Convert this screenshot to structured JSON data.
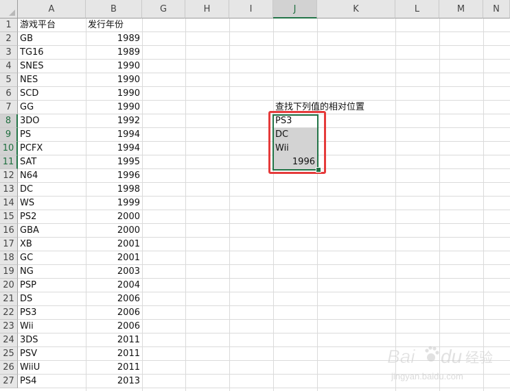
{
  "columns": [
    "A",
    "B",
    "G",
    "H",
    "I",
    "J",
    "K",
    "L",
    "M",
    "N"
  ],
  "selected_column": "J",
  "selected_rows": [
    8,
    9,
    10,
    11
  ],
  "rows": [
    {
      "num": "1",
      "a": "游戏平台",
      "b": "发行年份"
    },
    {
      "num": "2",
      "a": "GB",
      "b": "1989"
    },
    {
      "num": "3",
      "a": "TG16",
      "b": "1989"
    },
    {
      "num": "4",
      "a": "SNES",
      "b": "1990"
    },
    {
      "num": "5",
      "a": "NES",
      "b": "1990"
    },
    {
      "num": "6",
      "a": "SCD",
      "b": "1990"
    },
    {
      "num": "7",
      "a": "GG",
      "b": "1990"
    },
    {
      "num": "8",
      "a": "3DO",
      "b": "1992"
    },
    {
      "num": "9",
      "a": "PS",
      "b": "1994"
    },
    {
      "num": "10",
      "a": "PCFX",
      "b": "1994"
    },
    {
      "num": "11",
      "a": "SAT",
      "b": "1995"
    },
    {
      "num": "12",
      "a": "N64",
      "b": "1996"
    },
    {
      "num": "13",
      "a": "DC",
      "b": "1998"
    },
    {
      "num": "14",
      "a": "WS",
      "b": "1999"
    },
    {
      "num": "15",
      "a": "PS2",
      "b": "2000"
    },
    {
      "num": "16",
      "a": "GBA",
      "b": "2000"
    },
    {
      "num": "17",
      "a": "XB",
      "b": "2001"
    },
    {
      "num": "18",
      "a": "GC",
      "b": "2001"
    },
    {
      "num": "19",
      "a": "NG",
      "b": "2003"
    },
    {
      "num": "20",
      "a": "PSP",
      "b": "2004"
    },
    {
      "num": "21",
      "a": "DS",
      "b": "2006"
    },
    {
      "num": "22",
      "a": "PS3",
      "b": "2006"
    },
    {
      "num": "23",
      "a": "Wii",
      "b": "2006"
    },
    {
      "num": "24",
      "a": "3DS",
      "b": "2011"
    },
    {
      "num": "25",
      "a": "PSV",
      "b": "2011"
    },
    {
      "num": "26",
      "a": "WiiU",
      "b": "2011"
    },
    {
      "num": "27",
      "a": "PS4",
      "b": "2013"
    }
  ],
  "lookup": {
    "title": "查找下列值的相对位置",
    "values": [
      "PS3",
      "DC",
      "Wii",
      "1996"
    ]
  },
  "watermark": {
    "brand": "Bai",
    "brand2": "du",
    "label": "经验",
    "url": "jingyan.baidu.com"
  },
  "colors": {
    "excel_green": "#217346",
    "highlight_red": "#e53a3a",
    "selection_gray": "#d3d3d3"
  }
}
